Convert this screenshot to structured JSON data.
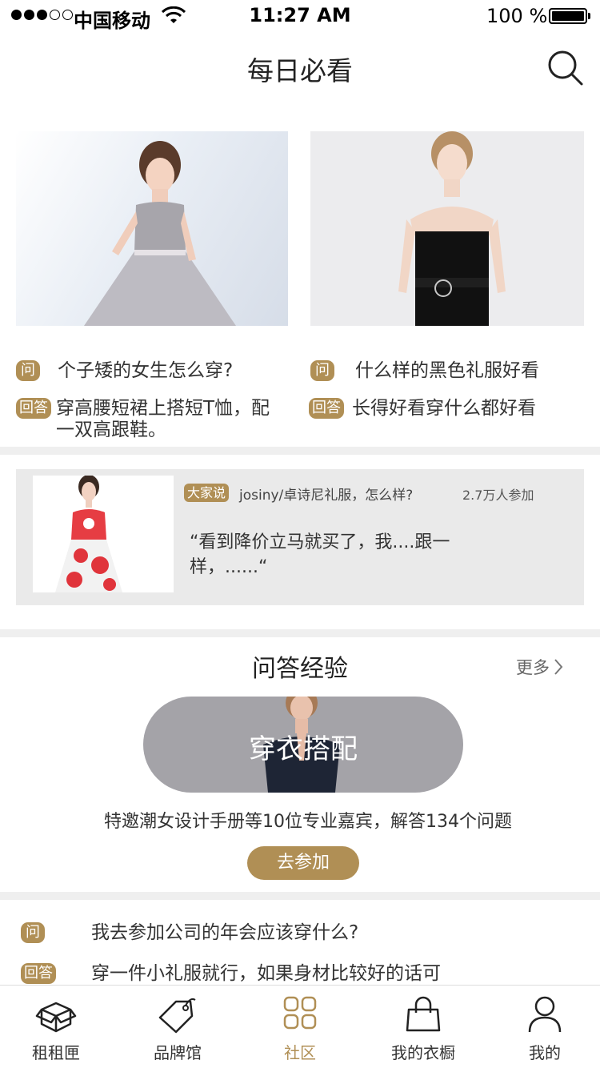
{
  "status_bar": {
    "carrier": "中国移动",
    "time": "11:27 AM",
    "battery": "100 %"
  },
  "nav": {
    "title": "每日必看"
  },
  "featured": [
    {
      "question_badge": "问",
      "question": "个子矮的女生怎么穿?",
      "answer_badge": "回答",
      "answer": "穿高腰短裙上搭短T恤，配一双高跟鞋。"
    },
    {
      "question_badge": "问",
      "question": "什么样的黑色礼服好看",
      "answer_badge": "回答",
      "answer": "长得好看穿什么都好看"
    }
  ],
  "discussion": {
    "badge": "大家说",
    "topic": "josiny/卓诗尼礼服，怎么样?",
    "count": "2.7万人参加",
    "quote": "“看到降价立马就买了，我....跟一样，......“"
  },
  "qa_section": {
    "title": "问答经验",
    "more": "更多",
    "promo_title": "穿衣搭配",
    "promo_desc": "特邀潮女设计手册等10位专业嘉宾，解答134个问题",
    "join_label": "去参加"
  },
  "qa_item": {
    "question_badge": "问",
    "question": "我去参加公司的年会应该穿什么?",
    "answer_badge": "回答",
    "answer": "穿一件小礼服就行，如果身材比较好的话可"
  },
  "tabs": [
    {
      "label": "租租匣",
      "icon": "box-icon",
      "active": false
    },
    {
      "label": "品牌馆",
      "icon": "tag-icon",
      "active": false
    },
    {
      "label": "社区",
      "icon": "grid-icon",
      "active": true
    },
    {
      "label": "我的衣橱",
      "icon": "bag-icon",
      "active": false
    },
    {
      "label": "我的",
      "icon": "user-icon",
      "active": false
    }
  ],
  "colors": {
    "accent": "#b08f55",
    "divider": "#efefef",
    "promo_bg": "#a4a3a8"
  }
}
